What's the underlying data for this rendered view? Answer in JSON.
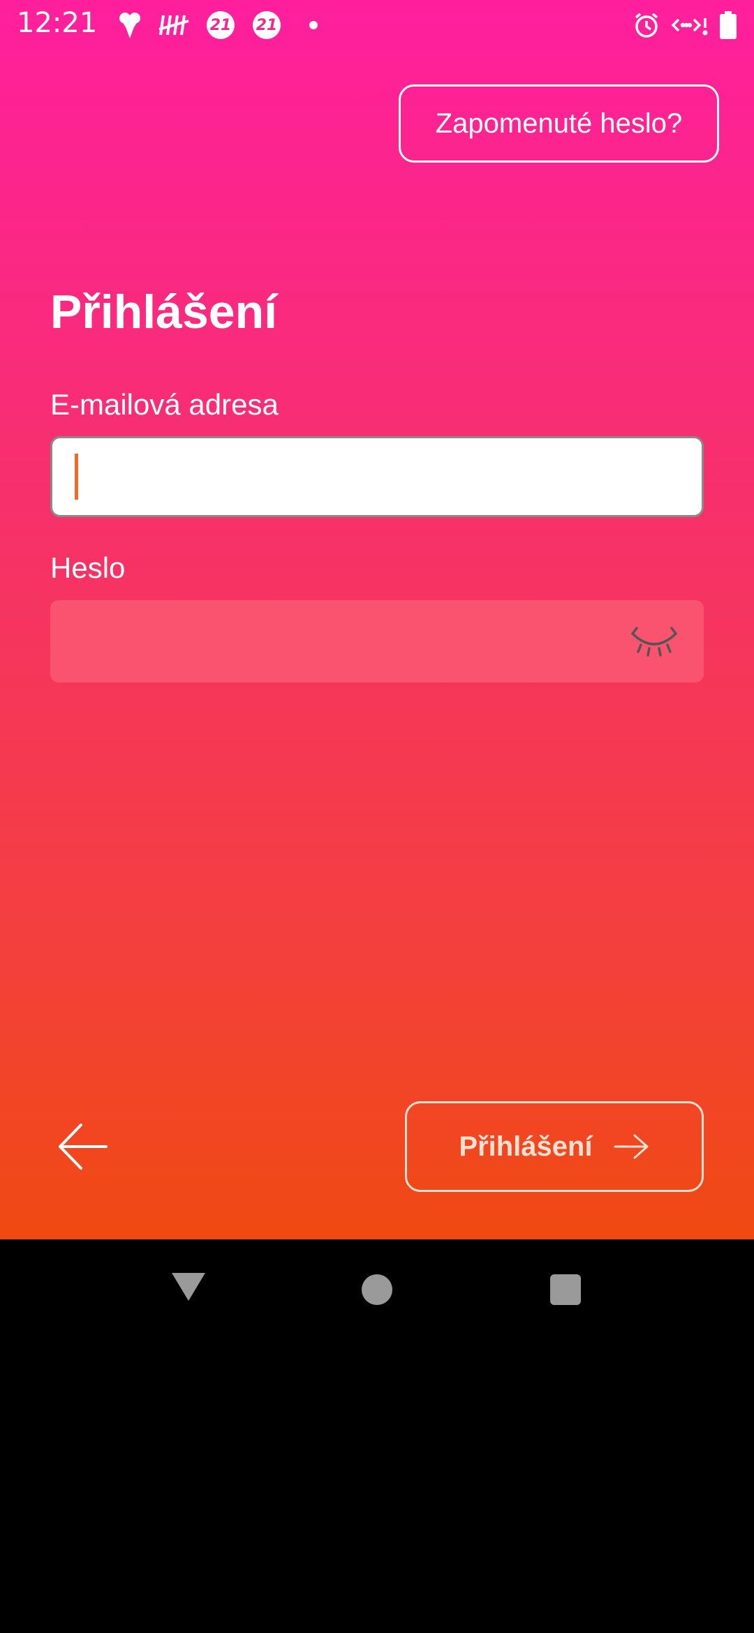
{
  "status_bar": {
    "time": "12:21",
    "badge_1": "21",
    "badge_2": "21",
    "icons": [
      "ice-cream-icon",
      "tally-icon",
      "badge-21-icon",
      "badge-21-icon",
      "dot-icon",
      "alarm-icon",
      "data-arrows-icon",
      "battery-icon"
    ]
  },
  "header": {
    "forgot_password_label": "Zapomenuté heslo?"
  },
  "form": {
    "title": "Přihlášení",
    "email_label": "E-mailová adresa",
    "email_value": "",
    "password_label": "Heslo",
    "password_value": ""
  },
  "footer": {
    "login_button_label": "Přihlášení"
  },
  "colors": {
    "gradient_top": "#ff1f9e",
    "gradient_bottom": "#f04a12",
    "caret": "#f06a2a",
    "password_field_bg": "#f9536f"
  },
  "nav_bar": {
    "icons": [
      "nav-back-icon",
      "nav-home-icon",
      "nav-recents-icon"
    ]
  }
}
